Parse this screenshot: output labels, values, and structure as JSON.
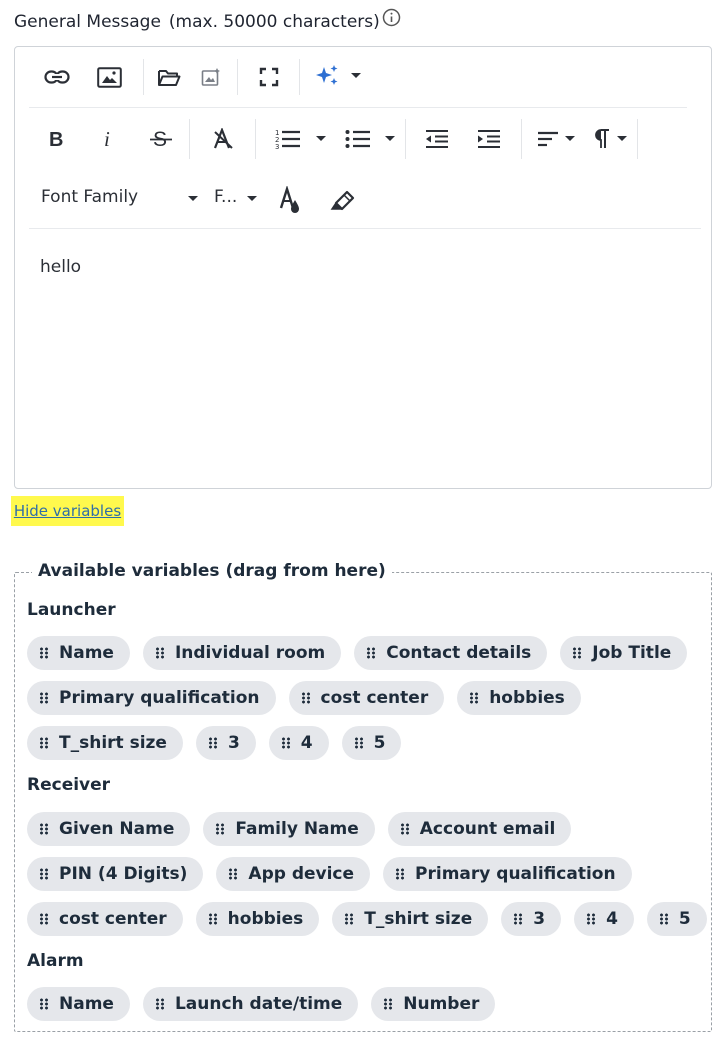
{
  "field": {
    "label": "General Message",
    "hint": "(max. 50000 characters)",
    "info_icon": "info-circle-icon"
  },
  "toolbar": {
    "font_family": "Font Family",
    "font_size": "F...",
    "icons": [
      "link-icon",
      "image-icon",
      "folder-open-icon",
      "ai-image-icon",
      "fullscreen-icon",
      "ai-sparkle-icon",
      "bold-icon",
      "italic-icon",
      "strikethrough-icon",
      "clear-format-icon",
      "numbered-list-icon",
      "bullet-list-icon",
      "outdent-icon",
      "indent-icon",
      "align-left-icon",
      "paragraph-icon",
      "font-color-icon",
      "highlighter-icon"
    ],
    "accent_color": "#2d6fd2"
  },
  "editor": {
    "content": "hello"
  },
  "hide_variables": {
    "label": "Hide variables",
    "highlight_color": "#fff94d"
  },
  "variables": {
    "legend": "Available variables (drag from here)",
    "groups": [
      {
        "title": "Launcher",
        "items": [
          "Name",
          "Individual room",
          "Contact details",
          "Job Title",
          "Primary qualification",
          "cost center",
          "hobbies",
          "T_shirt size",
          "3",
          "4",
          "5"
        ]
      },
      {
        "title": "Receiver",
        "items": [
          "Given Name",
          "Family Name",
          "Account email",
          "PIN (4 Digits)",
          "App device",
          "Primary qualification",
          "cost center",
          "hobbies",
          "T_shirt size",
          "3",
          "4",
          "5"
        ]
      },
      {
        "title": "Alarm",
        "items": [
          "Name",
          "Launch date/time",
          "Number"
        ]
      }
    ]
  }
}
